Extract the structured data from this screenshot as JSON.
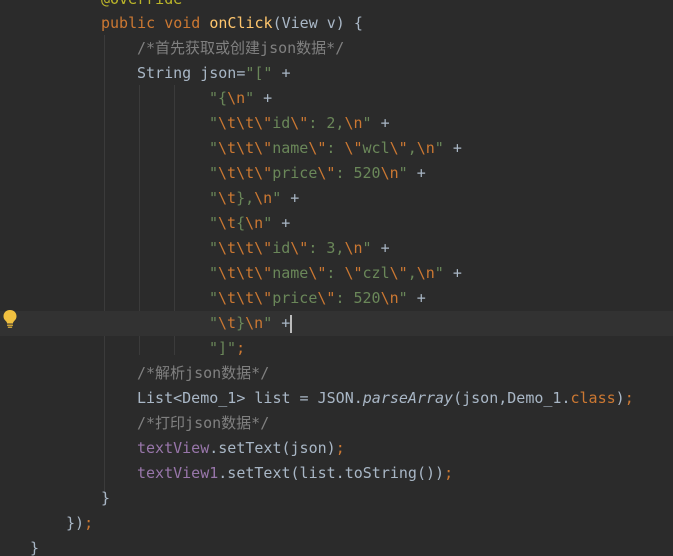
{
  "editor": {
    "lines": [
      {
        "segments": [
          {
            "t": "@Override",
            "c": "ann"
          }
        ]
      },
      {
        "segments": [
          {
            "t": "public void ",
            "c": "kw"
          },
          {
            "t": "onClick",
            "c": "fn"
          },
          {
            "t": "(View v) {",
            "c": ""
          }
        ]
      },
      {
        "segments": [
          {
            "t": "/*首先获取或创建json数据*/",
            "c": "cm"
          }
        ]
      },
      {
        "segments": [
          {
            "t": "String json=",
            "c": ""
          },
          {
            "t": "\"[\"",
            "c": "str"
          },
          {
            "t": " +",
            "c": ""
          }
        ]
      },
      {
        "segments": [
          {
            "t": "\"{",
            "c": "str"
          },
          {
            "t": "\\n",
            "c": "esc"
          },
          {
            "t": "\"",
            "c": "str"
          },
          {
            "t": " +",
            "c": ""
          }
        ]
      },
      {
        "segments": [
          {
            "t": "\"",
            "c": "str"
          },
          {
            "t": "\\t\\t\\\"",
            "c": "esc"
          },
          {
            "t": "id",
            "c": "str"
          },
          {
            "t": "\\\"",
            "c": "esc"
          },
          {
            "t": ": 2,",
            "c": "str"
          },
          {
            "t": "\\n",
            "c": "esc"
          },
          {
            "t": "\"",
            "c": "str"
          },
          {
            "t": " +",
            "c": ""
          }
        ]
      },
      {
        "segments": [
          {
            "t": "\"",
            "c": "str"
          },
          {
            "t": "\\t\\t\\\"",
            "c": "esc"
          },
          {
            "t": "name",
            "c": "str"
          },
          {
            "t": "\\\"",
            "c": "esc"
          },
          {
            "t": ": ",
            "c": "str"
          },
          {
            "t": "\\\"",
            "c": "esc"
          },
          {
            "t": "wcl",
            "c": "str"
          },
          {
            "t": "\\\"",
            "c": "esc"
          },
          {
            "t": ",",
            "c": "str"
          },
          {
            "t": "\\n",
            "c": "esc"
          },
          {
            "t": "\"",
            "c": "str"
          },
          {
            "t": " +",
            "c": ""
          }
        ]
      },
      {
        "segments": [
          {
            "t": "\"",
            "c": "str"
          },
          {
            "t": "\\t\\t\\\"",
            "c": "esc"
          },
          {
            "t": "price",
            "c": "str"
          },
          {
            "t": "\\\"",
            "c": "esc"
          },
          {
            "t": ": 520",
            "c": "str"
          },
          {
            "t": "\\n",
            "c": "esc"
          },
          {
            "t": "\"",
            "c": "str"
          },
          {
            "t": " +",
            "c": ""
          }
        ]
      },
      {
        "segments": [
          {
            "t": "\"",
            "c": "str"
          },
          {
            "t": "\\t",
            "c": "esc"
          },
          {
            "t": "},",
            "c": "str"
          },
          {
            "t": "\\n",
            "c": "esc"
          },
          {
            "t": "\"",
            "c": "str"
          },
          {
            "t": " +",
            "c": ""
          }
        ]
      },
      {
        "segments": [
          {
            "t": "\"",
            "c": "str"
          },
          {
            "t": "\\t",
            "c": "esc"
          },
          {
            "t": "{",
            "c": "str"
          },
          {
            "t": "\\n",
            "c": "esc"
          },
          {
            "t": "\"",
            "c": "str"
          },
          {
            "t": " +",
            "c": ""
          }
        ]
      },
      {
        "segments": [
          {
            "t": "\"",
            "c": "str"
          },
          {
            "t": "\\t\\t\\\"",
            "c": "esc"
          },
          {
            "t": "id",
            "c": "str"
          },
          {
            "t": "\\\"",
            "c": "esc"
          },
          {
            "t": ": 3,",
            "c": "str"
          },
          {
            "t": "\\n",
            "c": "esc"
          },
          {
            "t": "\"",
            "c": "str"
          },
          {
            "t": " +",
            "c": ""
          }
        ]
      },
      {
        "segments": [
          {
            "t": "\"",
            "c": "str"
          },
          {
            "t": "\\t\\t\\\"",
            "c": "esc"
          },
          {
            "t": "name",
            "c": "str"
          },
          {
            "t": "\\\"",
            "c": "esc"
          },
          {
            "t": ": ",
            "c": "str"
          },
          {
            "t": "\\\"",
            "c": "esc"
          },
          {
            "t": "czl",
            "c": "str"
          },
          {
            "t": "\\\"",
            "c": "esc"
          },
          {
            "t": ",",
            "c": "str"
          },
          {
            "t": "\\n",
            "c": "esc"
          },
          {
            "t": "\"",
            "c": "str"
          },
          {
            "t": " +",
            "c": ""
          }
        ]
      },
      {
        "segments": [
          {
            "t": "\"",
            "c": "str"
          },
          {
            "t": "\\t\\t\\\"",
            "c": "esc"
          },
          {
            "t": "price",
            "c": "str"
          },
          {
            "t": "\\\"",
            "c": "esc"
          },
          {
            "t": ": 520",
            "c": "str"
          },
          {
            "t": "\\n",
            "c": "esc"
          },
          {
            "t": "\"",
            "c": "str"
          },
          {
            "t": " +",
            "c": ""
          }
        ]
      },
      {
        "segments": [
          {
            "t": "\"",
            "c": "str"
          },
          {
            "t": "\\t",
            "c": "esc"
          },
          {
            "t": "}",
            "c": "str"
          },
          {
            "t": "\\n",
            "c": "esc"
          },
          {
            "t": "\"",
            "c": "str"
          },
          {
            "t": " +",
            "c": ""
          }
        ]
      },
      {
        "segments": [
          {
            "t": "\"]\"",
            "c": "str"
          },
          {
            "t": ";",
            "c": "kw"
          }
        ]
      },
      {
        "segments": [
          {
            "t": "/*解析json数据*/",
            "c": "cm"
          }
        ]
      },
      {
        "segments": [
          {
            "t": "List<Demo_1> list = JSON.",
            "c": ""
          },
          {
            "t": "parseArray",
            "c": "italic"
          },
          {
            "t": "(json,Demo_1.",
            "c": ""
          },
          {
            "t": "class",
            "c": "kw"
          },
          {
            "t": ")",
            "c": ""
          },
          {
            "t": ";",
            "c": "kw"
          }
        ]
      },
      {
        "segments": [
          {
            "t": "/*打印json数据*/",
            "c": "cm"
          }
        ]
      },
      {
        "segments": [
          {
            "t": "textView",
            "c": "field"
          },
          {
            "t": ".setText(json)",
            "c": ""
          },
          {
            "t": ";",
            "c": "kw"
          }
        ]
      },
      {
        "segments": [
          {
            "t": "textView1",
            "c": "field"
          },
          {
            "t": ".setText(list.toString())",
            "c": ""
          },
          {
            "t": ";",
            "c": "kw"
          }
        ]
      },
      {
        "segments": [
          {
            "t": "}",
            "c": ""
          }
        ]
      },
      {
        "segments": [
          {
            "t": "})",
            "c": ""
          },
          {
            "t": ";",
            "c": "kw"
          }
        ]
      },
      {
        "segments": [
          {
            "t": "}",
            "c": ""
          }
        ]
      }
    ],
    "current_line": 13,
    "icons": {
      "intention_bulb": "lightbulb-icon",
      "text_caret": "caret"
    },
    "colors": {
      "background": "#2b2b2b",
      "current_line": "#323232",
      "keyword": "#cc7832",
      "function": "#ffc66d",
      "string": "#6a8759",
      "comment": "#808080",
      "field": "#9876aa",
      "default": "#a9b7c6"
    }
  }
}
